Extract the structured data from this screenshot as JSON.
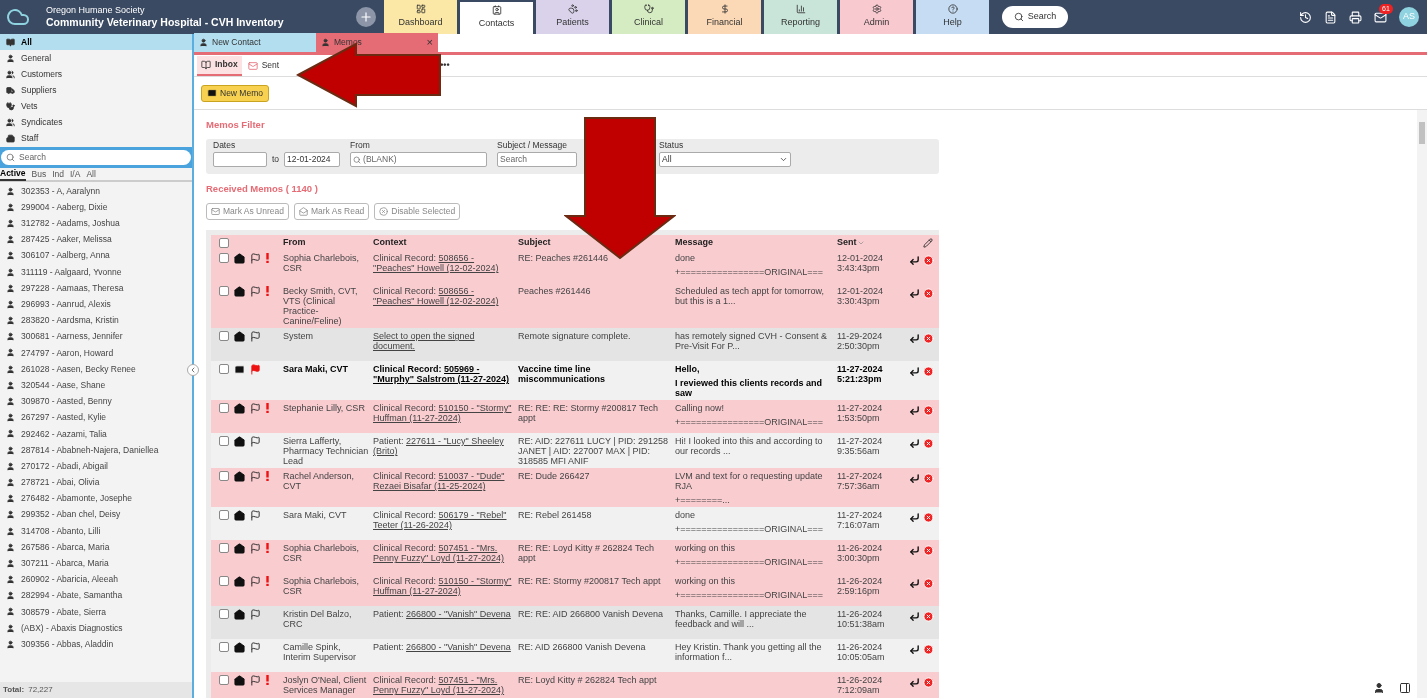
{
  "header": {
    "org": "Oregon Humane Society",
    "title": "Community Veterinary Hospital - CVH Inventory",
    "search": "Search",
    "mail_count": "61",
    "avatar": "AS"
  },
  "nav_tabs": [
    {
      "label": "Dashboard",
      "color": "#fbe8a6",
      "selected": false
    },
    {
      "label": "Contacts",
      "color": "#ffffff",
      "selected": true
    },
    {
      "label": "Patients",
      "color": "#d9d2ea",
      "selected": false
    },
    {
      "label": "Clinical",
      "color": "#d5ecc2",
      "selected": false
    },
    {
      "label": "Financial",
      "color": "#fcd9b6",
      "selected": false
    },
    {
      "label": "Reporting",
      "color": "#c9e4d9",
      "selected": false
    },
    {
      "label": "Admin",
      "color": "#f9c9d0",
      "selected": false
    },
    {
      "label": "Help",
      "color": "#c5dcf2",
      "selected": false
    }
  ],
  "sidebar": {
    "categories": [
      {
        "label": "All",
        "selected": true
      },
      {
        "label": "General",
        "selected": false
      },
      {
        "label": "Customers",
        "selected": false
      },
      {
        "label": "Suppliers",
        "selected": false
      },
      {
        "label": "Vets",
        "selected": false
      },
      {
        "label": "Syndicates",
        "selected": false
      },
      {
        "label": "Staff",
        "selected": false
      }
    ],
    "search_placeholder": "Search",
    "filters": [
      {
        "label": "Active",
        "selected": true
      },
      {
        "label": "Bus",
        "selected": false
      },
      {
        "label": "Ind",
        "selected": false
      },
      {
        "label": "I/A",
        "selected": false
      },
      {
        "label": "All",
        "selected": false
      }
    ],
    "contacts": [
      "302353 - A, Aaralynn",
      "299004 - Aaberg, Dixie",
      "312782 - Aadams, Joshua",
      "287425 - Aaker, Melissa",
      "306107 - Aalberg, Anna",
      "311119 - Aalgaard, Yvonne",
      "297228 - Aamaas, Theresa",
      "296993 - Aanrud, Alexis",
      "283820 - Aardsma, Kristin",
      "300681 - Aarness, Jennifer",
      "274797 - Aaron, Howard",
      "261028 - Aasen, Becky Renee",
      "320544 - Aase, Shane",
      "309870 - Aasted, Benny",
      "267297 - Aasted, Kylie",
      "292462 - Aazami, Talia",
      "287814 - Ababneh-Najera, Daniellea",
      "270172 - Abadi, Abigail",
      "278721 - Abai, Olivia",
      "276482 - Abamonte, Josephe",
      "299352 - Aban chel, Deisy",
      "314708 - Abanto, Lilli",
      "267586 - Abarca, Maria",
      "307211 - Abarca, Maria",
      "260902 - Abaricia, Aleeah",
      "282994 - Abate, Samantha",
      "308579 - Abate, Sierra",
      "(ABX) - Abaxis Diagnostics",
      "309356 - Abbas, Aladdin"
    ],
    "total_label": "Total:",
    "total": "72,227"
  },
  "doc_tabs": [
    {
      "label": "New Contact",
      "selected": false
    },
    {
      "label": "Memos",
      "selected": true,
      "close": "×"
    }
  ],
  "memo_tabs": [
    {
      "label": "Inbox",
      "selected": true
    },
    {
      "label": "Sent",
      "selected": false
    }
  ],
  "more": "•••",
  "new_memo": "New Memo",
  "filter": {
    "title": "Memos Filter",
    "dates_label": "Dates",
    "to": "to",
    "date_to": "12-01-2024",
    "from_label": "From",
    "from_placeholder": "(BLANK)",
    "subject_label": "Subject / Message",
    "subject_placeholder": "Search",
    "status_label": "Status",
    "status": "All"
  },
  "received_title": "Received Memos ( 1140 )",
  "actions": [
    "Mark As Unread",
    "Mark As Read",
    "Disable Selected"
  ],
  "table": {
    "select_all_checked": false,
    "columns": [
      "From",
      "Context",
      "Subject",
      "Message",
      "Sent"
    ],
    "rows": [
      {
        "from": "Sophia Charlebois, CSR",
        "context_prefix": "Clinical Record:",
        "context_link": "508656 - \"Peaches\" Howell (12-02-2024)",
        "subject": "RE: Peaches #261446",
        "message": [
          "done",
          "+================ORIGINAL==="
        ],
        "date": "12-01-2024",
        "time": "3:43:43pm",
        "checked": false,
        "unread": false,
        "flagged": false,
        "urgent": true
      },
      {
        "from": "Becky Smith, CVT, VTS (Clinical Practice-Canine/Feline)",
        "context_prefix": "Clinical Record:",
        "context_link": "508656 - \"Peaches\" Howell (12-02-2024)",
        "subject": "Peaches #261446",
        "message": [
          "Scheduled as tech appt for tomorrow, but this is a 1..."
        ],
        "date": "12-01-2024",
        "time": "3:30:43pm",
        "checked": false,
        "unread": false,
        "flagged": false,
        "urgent": true
      },
      {
        "from": "System",
        "context_prefix": "",
        "context_link": "Select to open the signed document.",
        "subject": "Remote signature complete.",
        "message": [
          "has remotely signed CVH - Consent & Pre-Visit For P..."
        ],
        "date": "11-29-2024",
        "time": "2:50:30pm",
        "checked": false,
        "unread": false,
        "flagged": false,
        "urgent": false
      },
      {
        "from": "Sara Maki, CVT",
        "context_prefix": "Clinical Record:",
        "context_link": "505969 - \"Murphy\" Salstrom (11-27-2024)",
        "subject": "Vaccine time line miscommunications",
        "message": [
          "Hello,",
          "I reviewed this clients records and saw"
        ],
        "date": "11-27-2024",
        "time": "5:21:23pm",
        "checked": false,
        "unread": true,
        "flagged": true,
        "urgent": false
      },
      {
        "from": "Stephanie Lilly, CSR",
        "context_prefix": "Clinical Record:",
        "context_link": "510150 - \"Stormy\" Huffman (11-27-2024)",
        "subject": "RE: RE: RE: Stormy #200817 Tech appt",
        "message": [
          "Calling now!",
          "+================ORIGINAL==="
        ],
        "date": "11-27-2024",
        "time": "1:53:50pm",
        "checked": false,
        "unread": false,
        "flagged": false,
        "urgent": true
      },
      {
        "from": "Sierra Lafferty, Pharmacy Technician Lead",
        "context_prefix": "Patient:",
        "context_link": "227611 - \"Lucy\" Sheeley (Brito)",
        "subject": "RE: AID: 227611 LUCY | PID: 291258 JANET | AID: 227007 MAX | PID: 318585 MFI ANIF",
        "message": [
          "Hi! I looked into this and according to our records ..."
        ],
        "date": "11-27-2024",
        "time": "9:35:56am",
        "checked": false,
        "unread": false,
        "flagged": false,
        "urgent": false
      },
      {
        "from": "Rachel Anderson, CVT",
        "context_prefix": "Clinical Record:",
        "context_link": "510037 - \"Dude\" Rezaei Bisafar (11-25-2024)",
        "subject": "RE: Dude 266427",
        "message": [
          "LVM and text for o requesting update RJA",
          "+========..."
        ],
        "date": "11-27-2024",
        "time": "7:57:36am",
        "checked": false,
        "unread": false,
        "flagged": false,
        "urgent": true
      },
      {
        "from": "Sara Maki, CVT",
        "context_prefix": "Clinical Record:",
        "context_link": "506179 - \"Rebel\" Teeter (11-26-2024)",
        "subject": "RE: Rebel 261458",
        "message": [
          "done",
          "+================ORIGINAL==="
        ],
        "date": "11-27-2024",
        "time": "7:16:07am",
        "checked": false,
        "unread": false,
        "flagged": false,
        "urgent": false
      },
      {
        "from": "Sophia Charlebois, CSR",
        "context_prefix": "Clinical Record:",
        "context_link": "507451 - \"Mrs. Penny Fuzzy\" Loyd (11-27-2024)",
        "subject": "RE: RE: Loyd Kitty # 262824 Tech appt",
        "message": [
          "working on this",
          "+================ORIGINAL==="
        ],
        "date": "11-26-2024",
        "time": "3:00:30pm",
        "checked": false,
        "unread": false,
        "flagged": false,
        "urgent": true
      },
      {
        "from": "Sophia Charlebois, CSR",
        "context_prefix": "Clinical Record:",
        "context_link": "510150 - \"Stormy\" Huffman (11-27-2024)",
        "subject": "RE: RE: Stormy #200817 Tech appt",
        "message": [
          "working on this",
          "+================ORIGINAL==="
        ],
        "date": "11-26-2024",
        "time": "2:59:16pm",
        "checked": false,
        "unread": false,
        "flagged": false,
        "urgent": true
      },
      {
        "from": "Kristin Del Balzo, CRC",
        "context_prefix": "Patient:",
        "context_link": "266800 - \"Vanish\" Devena",
        "subject": "RE: RE: AID 266800 Vanish Devena",
        "message": [
          "Thanks, Camille. I appreciate the feedback and will ..."
        ],
        "date": "11-26-2024",
        "time": "10:51:38am",
        "checked": false,
        "unread": false,
        "flagged": false,
        "urgent": false
      },
      {
        "from": "Camille Spink, Interim Supervisor",
        "context_prefix": "Patient:",
        "context_link": "266800 - \"Vanish\" Devena",
        "subject": "RE: AID 266800 Vanish Devena",
        "message": [
          "Hey Kristin. Thank you getting all the information f..."
        ],
        "date": "11-26-2024",
        "time": "10:05:05am",
        "checked": false,
        "unread": false,
        "flagged": false,
        "urgent": false
      },
      {
        "from": "Joslyn O'Neal, Client Services Manager",
        "context_prefix": "Clinical Record:",
        "context_link": "507451 - \"Mrs. Penny Fuzzy\" Loyd (11-27-2024)",
        "subject": "RE: Loyd Kitty # 262824 Tech appt",
        "message": [],
        "date": "11-26-2024",
        "time": "7:12:09am",
        "checked": false,
        "unread": false,
        "flagged": false,
        "urgent": true
      }
    ]
  }
}
